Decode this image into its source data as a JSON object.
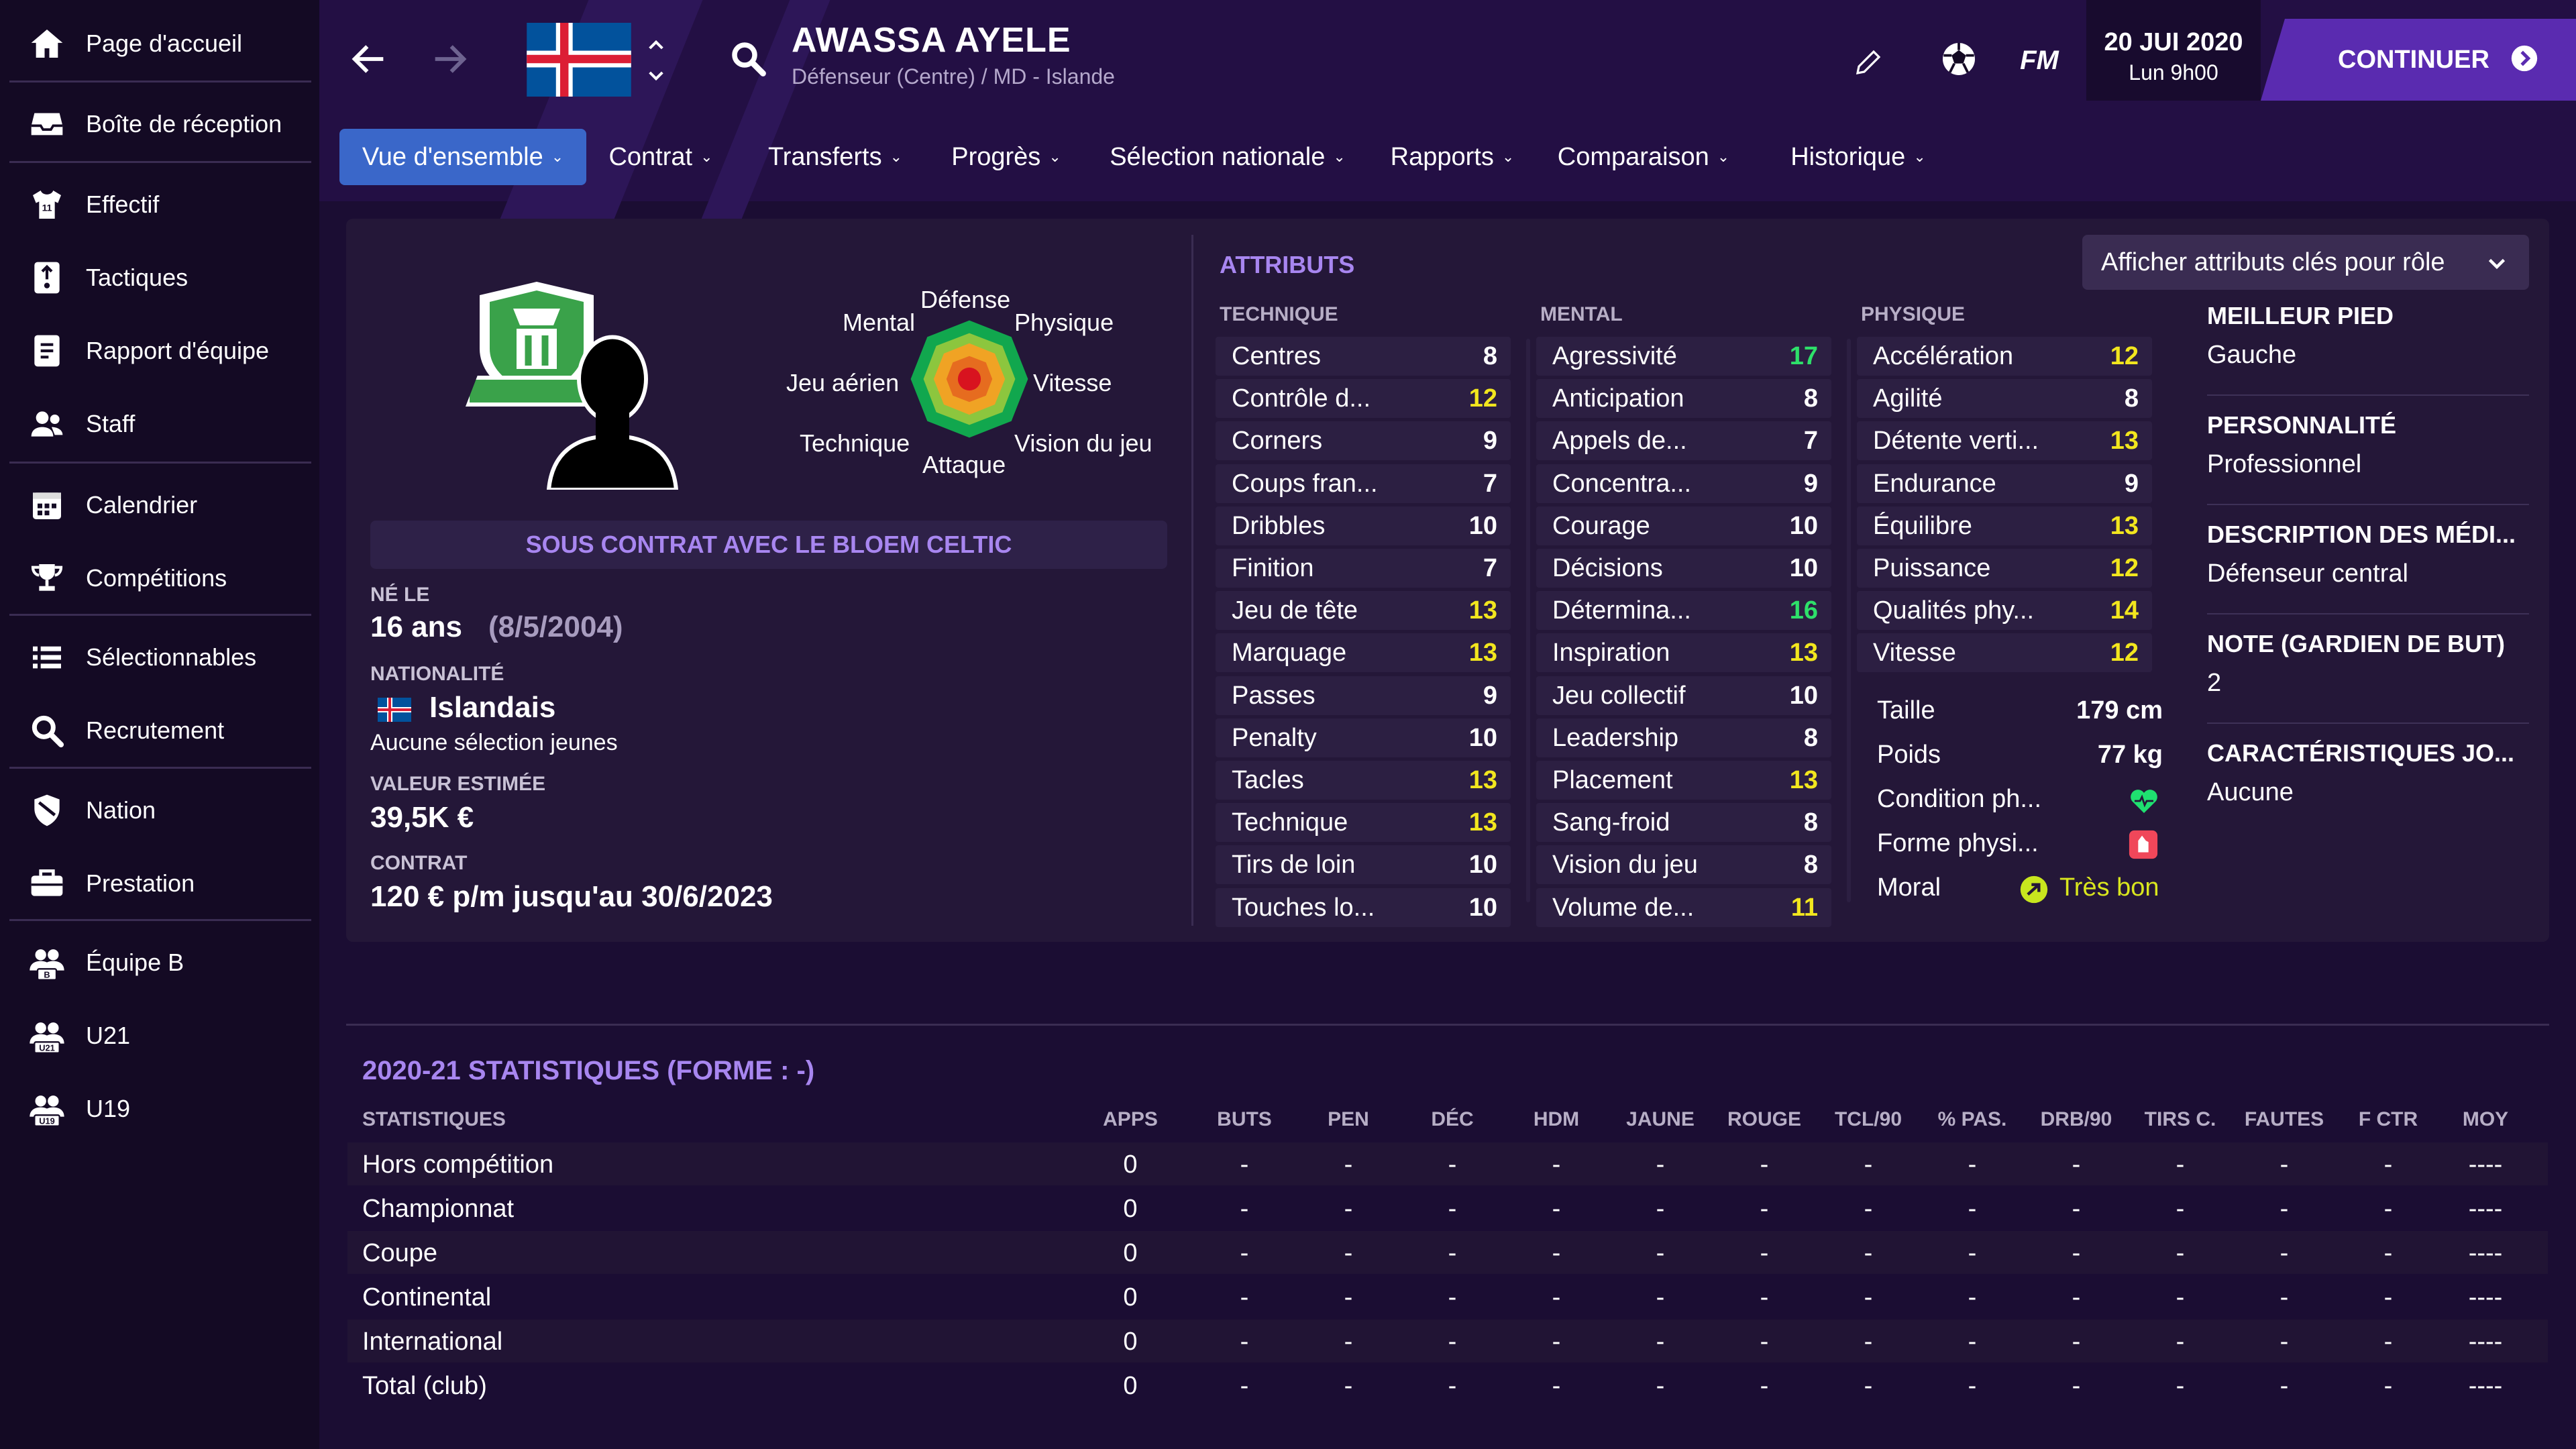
{
  "sidebar": {
    "items": [
      {
        "label": "Page d'accueil",
        "icon": "home-icon"
      },
      {
        "label": "Boîte de réception",
        "icon": "inbox-icon"
      },
      {
        "label": "Effectif",
        "icon": "shirt-icon"
      },
      {
        "label": "Tactiques",
        "icon": "tactics-board-icon"
      },
      {
        "label": "Rapport d'équipe",
        "icon": "report-icon"
      },
      {
        "label": "Staff",
        "icon": "staff-icon"
      },
      {
        "label": "Calendrier",
        "icon": "calendar-icon"
      },
      {
        "label": "Compétitions",
        "icon": "trophy-icon"
      },
      {
        "label": "Sélectionnables",
        "icon": "list-icon"
      },
      {
        "label": "Recrutement",
        "icon": "search-icon"
      },
      {
        "label": "Nation",
        "icon": "shield-icon"
      },
      {
        "label": "Prestation",
        "icon": "briefcase-icon"
      },
      {
        "label": "Équipe B",
        "icon": "team-b-icon",
        "badge": "B"
      },
      {
        "label": "U21",
        "icon": "team-u21-icon",
        "badge": "U21"
      },
      {
        "label": "U19",
        "icon": "team-u19-icon",
        "badge": "U19"
      }
    ]
  },
  "header": {
    "player_name": "AWASSA AYELE",
    "player_subtitle": "Défenseur (Centre) / MD - Islande",
    "fm_label": "FM",
    "date": "20 JUI 2020",
    "time": "Lun 9h00",
    "continue_label": "CONTINUER",
    "icons": [
      "back-arrow-icon",
      "forward-arrow-icon",
      "iceland-flag-icon",
      "search-icon",
      "pencil-icon",
      "ball-icon",
      "continue-arrow-icon"
    ]
  },
  "tabs": [
    {
      "label": "Vue d'ensemble",
      "active": true
    },
    {
      "label": "Contrat"
    },
    {
      "label": "Transferts"
    },
    {
      "label": "Progrès"
    },
    {
      "label": "Sélection nationale"
    },
    {
      "label": "Rapports"
    },
    {
      "label": "Comparaison"
    },
    {
      "label": "Historique"
    }
  ],
  "profile": {
    "radar_labels": {
      "defense": "Défense",
      "mental": "Mental",
      "physique": "Physique",
      "aerial": "Jeu aérien",
      "speed": "Vitesse",
      "technique": "Technique",
      "vision": "Vision du jeu",
      "attack": "Attaque"
    },
    "contract_banner": "SOUS CONTRAT AVEC LE BLOEM CELTIC",
    "born_label": "NÉ LE",
    "age": "16 ans",
    "birth_date": "(8/5/2004)",
    "nationality_label": "NATIONALITÉ",
    "nationality": "Islandais",
    "youth_caps": "Aucune sélection jeunes",
    "value_label": "VALEUR ESTIMÉE",
    "value": "39,5K €",
    "contract_label": "CONTRAT",
    "contract": "120 € p/m jusqu'au 30/6/2023"
  },
  "attributes": {
    "title": "ATTRIBUTS",
    "role_button": "Afficher attributs clés pour rôle",
    "technique": {
      "label": "TECHNIQUE",
      "items": [
        {
          "name": "Centres",
          "value": "8",
          "color": "white"
        },
        {
          "name": "Contrôle d...",
          "value": "12",
          "color": "yellow"
        },
        {
          "name": "Corners",
          "value": "9",
          "color": "white"
        },
        {
          "name": "Coups fran...",
          "value": "7",
          "color": "white"
        },
        {
          "name": "Dribbles",
          "value": "10",
          "color": "white"
        },
        {
          "name": "Finition",
          "value": "7",
          "color": "white"
        },
        {
          "name": "Jeu de tête",
          "value": "13",
          "color": "yellow"
        },
        {
          "name": "Marquage",
          "value": "13",
          "color": "yellow"
        },
        {
          "name": "Passes",
          "value": "9",
          "color": "white"
        },
        {
          "name": "Penalty",
          "value": "10",
          "color": "white"
        },
        {
          "name": "Tacles",
          "value": "13",
          "color": "yellow"
        },
        {
          "name": "Technique",
          "value": "13",
          "color": "yellow"
        },
        {
          "name": "Tirs de loin",
          "value": "10",
          "color": "white"
        },
        {
          "name": "Touches lo...",
          "value": "10",
          "color": "white"
        }
      ]
    },
    "mental": {
      "label": "MENTAL",
      "items": [
        {
          "name": "Agressivité",
          "value": "17",
          "color": "green"
        },
        {
          "name": "Anticipation",
          "value": "8",
          "color": "white"
        },
        {
          "name": "Appels de...",
          "value": "7",
          "color": "white"
        },
        {
          "name": "Concentra...",
          "value": "9",
          "color": "white"
        },
        {
          "name": "Courage",
          "value": "10",
          "color": "white"
        },
        {
          "name": "Décisions",
          "value": "10",
          "color": "white"
        },
        {
          "name": "Détermina...",
          "value": "16",
          "color": "green"
        },
        {
          "name": "Inspiration",
          "value": "13",
          "color": "yellow"
        },
        {
          "name": "Jeu collectif",
          "value": "10",
          "color": "white"
        },
        {
          "name": "Leadership",
          "value": "8",
          "color": "white"
        },
        {
          "name": "Placement",
          "value": "13",
          "color": "yellow"
        },
        {
          "name": "Sang-froid",
          "value": "8",
          "color": "white"
        },
        {
          "name": "Vision du jeu",
          "value": "8",
          "color": "white"
        },
        {
          "name": "Volume de...",
          "value": "11",
          "color": "yellow"
        }
      ]
    },
    "physique": {
      "label": "PHYSIQUE",
      "items": [
        {
          "name": "Accélération",
          "value": "12",
          "color": "yellow"
        },
        {
          "name": "Agilité",
          "value": "8",
          "color": "white"
        },
        {
          "name": "Détente verti...",
          "value": "13",
          "color": "yellow"
        },
        {
          "name": "Endurance",
          "value": "9",
          "color": "white"
        },
        {
          "name": "Équilibre",
          "value": "13",
          "color": "yellow"
        },
        {
          "name": "Puissance",
          "value": "12",
          "color": "yellow"
        },
        {
          "name": "Qualités phy...",
          "value": "14",
          "color": "yellow"
        },
        {
          "name": "Vitesse",
          "value": "12",
          "color": "yellow"
        }
      ]
    },
    "body": {
      "height_label": "Taille",
      "height": "179 cm",
      "weight_label": "Poids",
      "weight": "77 kg",
      "condition_label": "Condition ph...",
      "condition_icon": "heart-icon",
      "form_label": "Forme physi...",
      "form_icon": "injury-icon",
      "morale_label": "Moral",
      "morale": "Très bon",
      "morale_icon": "morale-arrow-icon"
    },
    "colors": {
      "white": "#ffffff",
      "yellow": "#f2e61e",
      "green": "#2ee06a"
    }
  },
  "info": [
    {
      "title": "MEILLEUR PIED",
      "value": "Gauche"
    },
    {
      "title": "PERSONNALITÉ",
      "value": "Professionnel"
    },
    {
      "title": "DESCRIPTION DES MÉDI...",
      "value": "Défenseur central"
    },
    {
      "title": "NOTE (GARDIEN DE BUT)",
      "value": "2"
    },
    {
      "title": "CARACTÉRISTIQUES JO...",
      "value": "Aucune"
    }
  ],
  "stats": {
    "title": "2020-21 STATISTIQUES (FORME : -)",
    "header_label": "STATISTIQUES",
    "columns": [
      "APPS",
      "BUTS",
      "PEN",
      "DÉC",
      "HDM",
      "JAUNE",
      "ROUGE",
      "TCL/90",
      "% PAS.",
      "DRB/90",
      "TIRS C.",
      "FAUTES",
      "F CTR",
      "MOY"
    ],
    "rows": [
      {
        "label": "Hors compétition",
        "cells": [
          "0",
          "-",
          "-",
          "-",
          "-",
          "-",
          "-",
          "-",
          "-",
          "-",
          "-",
          "-",
          "-",
          "----"
        ]
      },
      {
        "label": "Championnat",
        "cells": [
          "0",
          "-",
          "-",
          "-",
          "-",
          "-",
          "-",
          "-",
          "-",
          "-",
          "-",
          "-",
          "-",
          "----"
        ]
      },
      {
        "label": "Coupe",
        "cells": [
          "0",
          "-",
          "-",
          "-",
          "-",
          "-",
          "-",
          "-",
          "-",
          "-",
          "-",
          "-",
          "-",
          "----"
        ]
      },
      {
        "label": "Continental",
        "cells": [
          "0",
          "-",
          "-",
          "-",
          "-",
          "-",
          "-",
          "-",
          "-",
          "-",
          "-",
          "-",
          "-",
          "----"
        ]
      },
      {
        "label": "International",
        "cells": [
          "0",
          "-",
          "-",
          "-",
          "-",
          "-",
          "-",
          "-",
          "-",
          "-",
          "-",
          "-",
          "-",
          "----"
        ]
      },
      {
        "label": "Total (club)",
        "cells": [
          "0",
          "-",
          "-",
          "-",
          "-",
          "-",
          "-",
          "-",
          "-",
          "-",
          "-",
          "-",
          "-",
          "----"
        ]
      }
    ]
  },
  "theme": {
    "accent": "#5a2bb0",
    "tab_active": "#3a67c9",
    "heading_purple": "#a886f0"
  }
}
